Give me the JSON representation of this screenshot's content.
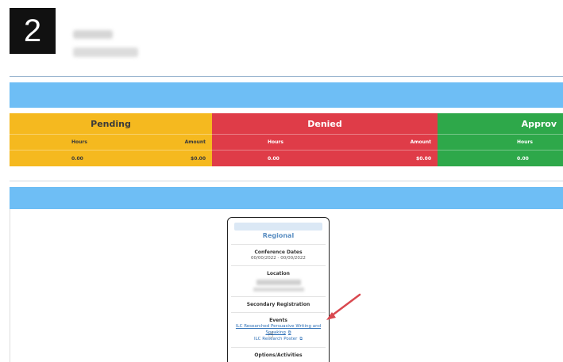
{
  "step_number": "2",
  "summary": {
    "pending": {
      "title": "Pending",
      "hours_label": "Hours",
      "amount_label": "Amount",
      "hours": "0.00",
      "amount": "$0.00"
    },
    "denied": {
      "title": "Denied",
      "hours_label": "Hours",
      "amount_label": "Amount",
      "hours": "0.00",
      "amount": "$0.00"
    },
    "approved": {
      "title": "Approv",
      "hours_label": "Hours",
      "hours": "0.00"
    }
  },
  "conference_card": {
    "title": "Regional",
    "dates_label": "Conference Dates",
    "dates_value": "00/00/2022 - 00/00/2022",
    "location_label": "Location",
    "secondary_label": "Secondary Registration",
    "events_label": "Events",
    "event_1": "ILC Researched Persuasive Writing and Speaking",
    "event_2": "ILC Research Poster",
    "options_label": "Options/Activities"
  },
  "colors": {
    "pending": "#f5b91f",
    "denied": "#df3c48",
    "approved": "#2ea84a",
    "band": "#6ebef5",
    "arrow": "#d9484f"
  },
  "icons": [
    "external-link-icon",
    "hand-cursor-icon",
    "red-arrow-annotation"
  ]
}
